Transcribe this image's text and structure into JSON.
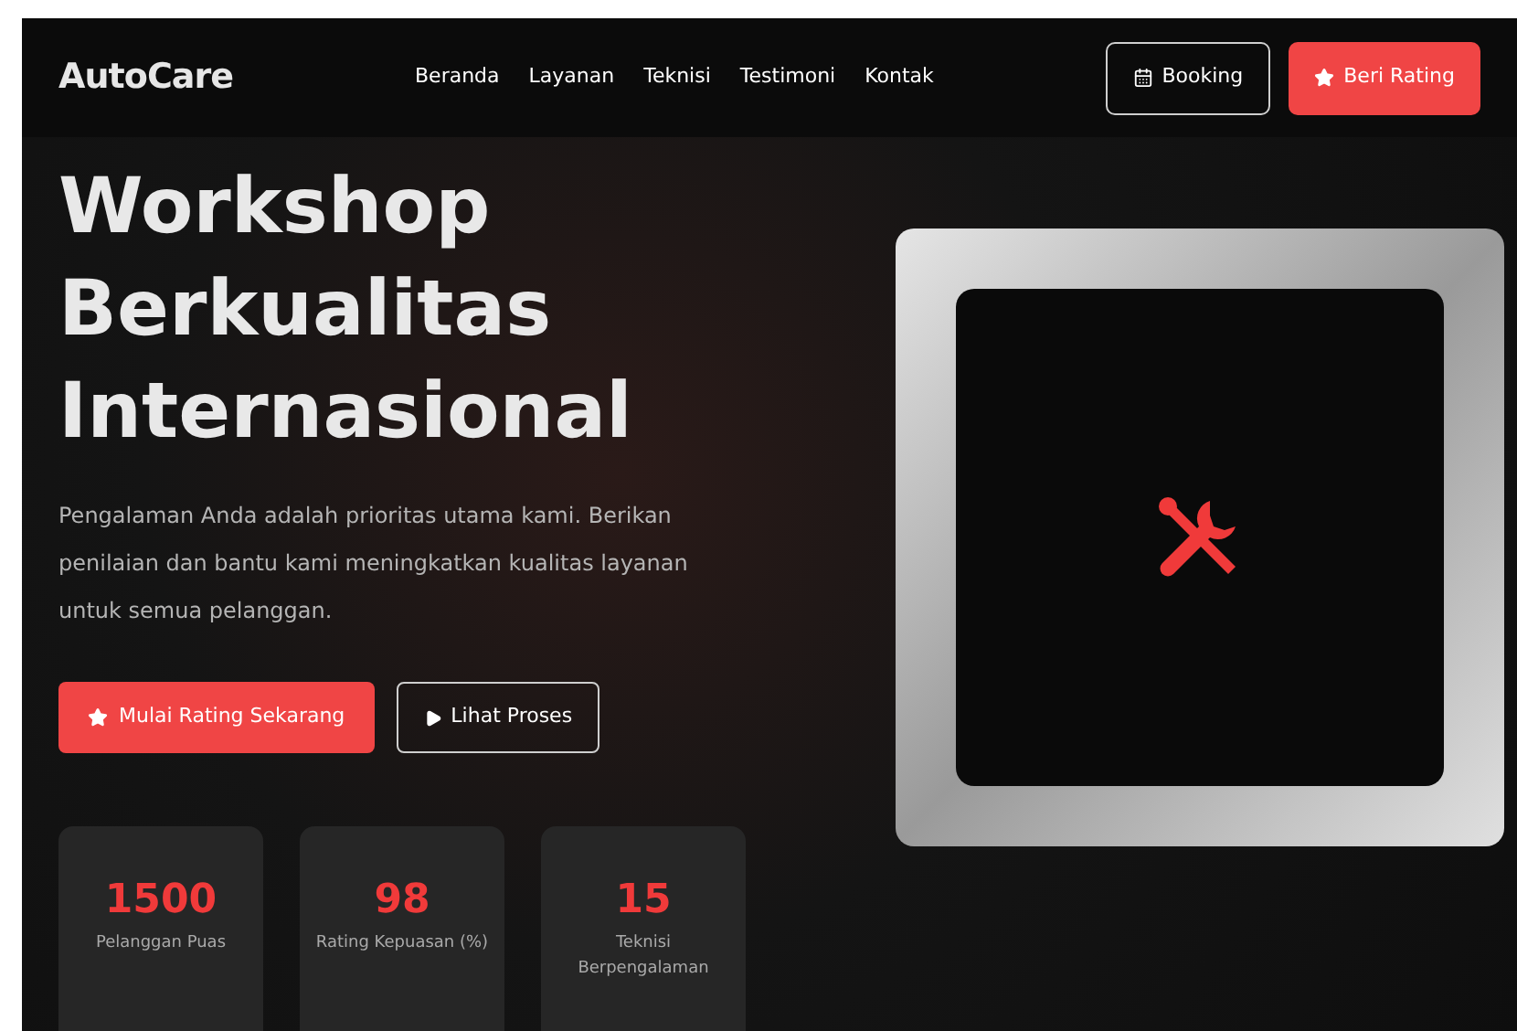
{
  "brand": "AutoCare",
  "nav": {
    "links": [
      "Beranda",
      "Layanan",
      "Teknisi",
      "Testimoni",
      "Kontak"
    ],
    "booking": "Booking",
    "rating": "Beri Rating"
  },
  "hero": {
    "title": [
      "Workshop",
      "Berkualitas",
      "Internasional"
    ],
    "description": "Pengalaman Anda adalah prioritas utama kami. Berikan penilaian dan bantu kami meningkatkan kualitas layanan untuk semua pelanggan.",
    "primary": "Mulai Rating Sekarang",
    "secondary": "Lihat Proses"
  },
  "stats": [
    {
      "value": "1500",
      "label": "Pelanggan Puas"
    },
    {
      "value": "98",
      "label": "Rating Kepuasan (%)"
    },
    {
      "value": "15",
      "label": "Teknisi Berpengalaman"
    }
  ]
}
